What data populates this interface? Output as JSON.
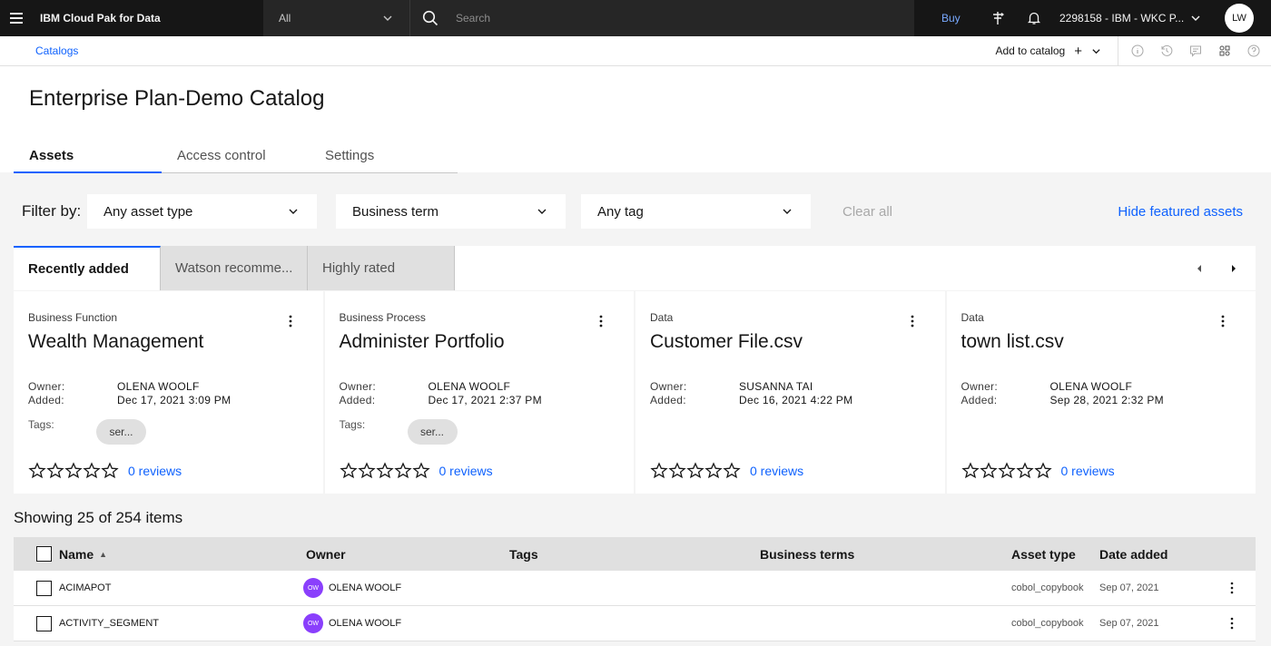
{
  "header": {
    "brand": "IBM Cloud Pak for Data",
    "scope": "All",
    "search_placeholder": "Search",
    "buy": "Buy",
    "account": "2298158 - IBM - WKC P...",
    "avatar": "LW"
  },
  "subheader": {
    "breadcrumb": "Catalogs",
    "add_to_catalog": "Add to catalog"
  },
  "page": {
    "title": "Enterprise Plan-Demo Catalog",
    "tabs": [
      {
        "label": "Assets"
      },
      {
        "label": "Access control"
      },
      {
        "label": "Settings"
      }
    ]
  },
  "filters": {
    "label": "Filter by:",
    "asset_type": "Any asset type",
    "business_term": "Business term",
    "tag": "Any tag",
    "clear_all": "Clear all",
    "hide_featured": "Hide featured assets"
  },
  "featured_tabs": [
    {
      "label": "Recently added"
    },
    {
      "label": "Watson recomme..."
    },
    {
      "label": "Highly rated"
    }
  ],
  "cards": [
    {
      "type": "Business Function",
      "title": "Wealth Management",
      "owner_label": "Owner:",
      "owner": "OLENA WOOLF",
      "added_label": "Added:",
      "added": "Dec 17, 2021 3:09 PM",
      "tags_label": "Tags:",
      "tag": "ser...",
      "reviews": "0 reviews"
    },
    {
      "type": "Business Process",
      "title": "Administer Portfolio",
      "owner_label": "Owner:",
      "owner": "OLENA WOOLF",
      "added_label": "Added:",
      "added": "Dec 17, 2021 2:37 PM",
      "tags_label": "Tags:",
      "tag": "ser...",
      "reviews": "0 reviews"
    },
    {
      "type": "Data",
      "title": "Customer File.csv",
      "owner_label": "Owner:",
      "owner": "SUSANNA TAI",
      "added_label": "Added:",
      "added": "Dec 16, 2021 4:22 PM",
      "reviews": "0 reviews"
    },
    {
      "type": "Data",
      "title": "town list.csv",
      "owner_label": "Owner:",
      "owner": "OLENA WOOLF",
      "added_label": "Added:",
      "added": "Sep 28, 2021 2:32 PM",
      "reviews": "0 reviews"
    }
  ],
  "list": {
    "showing": "Showing 25 of 254 items",
    "columns": {
      "name": "Name",
      "owner": "Owner",
      "tags": "Tags",
      "business_terms": "Business terms",
      "asset_type": "Asset type",
      "date_added": "Date added"
    },
    "rows": [
      {
        "name": "ACIMAPOT",
        "owner_initials": "OW",
        "owner": "OLENA WOOLF",
        "asset_type": "cobol_copybook",
        "date": "Sep 07, 2021"
      },
      {
        "name": "ACTIVITY_SEGMENT",
        "owner_initials": "OW",
        "owner": "OLENA WOOLF",
        "asset_type": "cobol_copybook",
        "date": "Sep 07, 2021"
      }
    ]
  },
  "colors": {
    "accent": "#0f62fe",
    "topbar": "#161616",
    "owner_avatar": "#8a3ffc"
  },
  "icons": [
    "menu-icon",
    "chevron-down-icon",
    "search-icon",
    "pin-icon",
    "notification-icon",
    "add-icon",
    "info-icon",
    "history-icon",
    "comment-icon",
    "apps-icon",
    "help-icon",
    "overflow-menu-icon",
    "star-icon",
    "caret-left-icon",
    "caret-right-icon",
    "sort-icon"
  ]
}
